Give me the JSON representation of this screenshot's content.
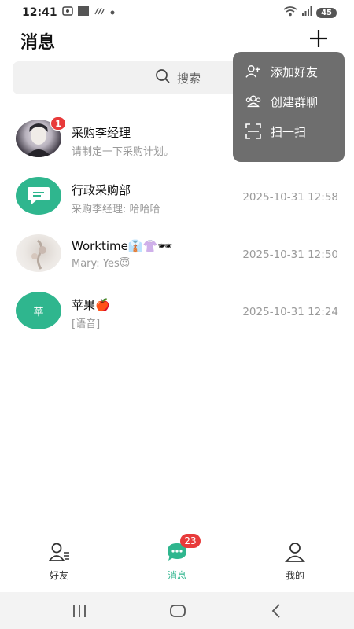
{
  "status_bar": {
    "time": "12:41",
    "battery": "45"
  },
  "header": {
    "title": "消息"
  },
  "search": {
    "placeholder": "搜索"
  },
  "popup_menu": [
    {
      "label": "添加好友",
      "icon": "add-friend-icon"
    },
    {
      "label": "创建群聊",
      "icon": "group-icon"
    },
    {
      "label": "扫一扫",
      "icon": "scan-icon"
    }
  ],
  "conversations": [
    {
      "name": "采购李经理",
      "preview": "请制定一下采购计划。",
      "time": "",
      "unread": "1",
      "avatar": "photo-avatar"
    },
    {
      "name": "行政采购部",
      "preview": "采购李经理: 哈哈哈",
      "time": "2025-10-31 12:58",
      "unread": "",
      "avatar": "group-chat-avatar"
    },
    {
      "name": "Worktime👔👚🕶",
      "preview": "Mary: Yes😇",
      "time": "2025-10-31 12:50",
      "unread": "",
      "avatar": "photo-avatar"
    },
    {
      "name": "苹果🍎",
      "preview": "[语音]",
      "time": "2025-10-31 12:24",
      "unread": "",
      "avatar": "text-avatar",
      "avatar_text": "苹"
    }
  ],
  "tabs": [
    {
      "label": "好友",
      "icon": "friends-icon"
    },
    {
      "label": "消息",
      "icon": "chat-icon",
      "badge": "23",
      "active": true
    },
    {
      "label": "我的",
      "icon": "profile-icon"
    }
  ],
  "colors": {
    "accent": "#2fb68e",
    "badge": "#e83a3a",
    "popup": "#6e6e6e"
  }
}
